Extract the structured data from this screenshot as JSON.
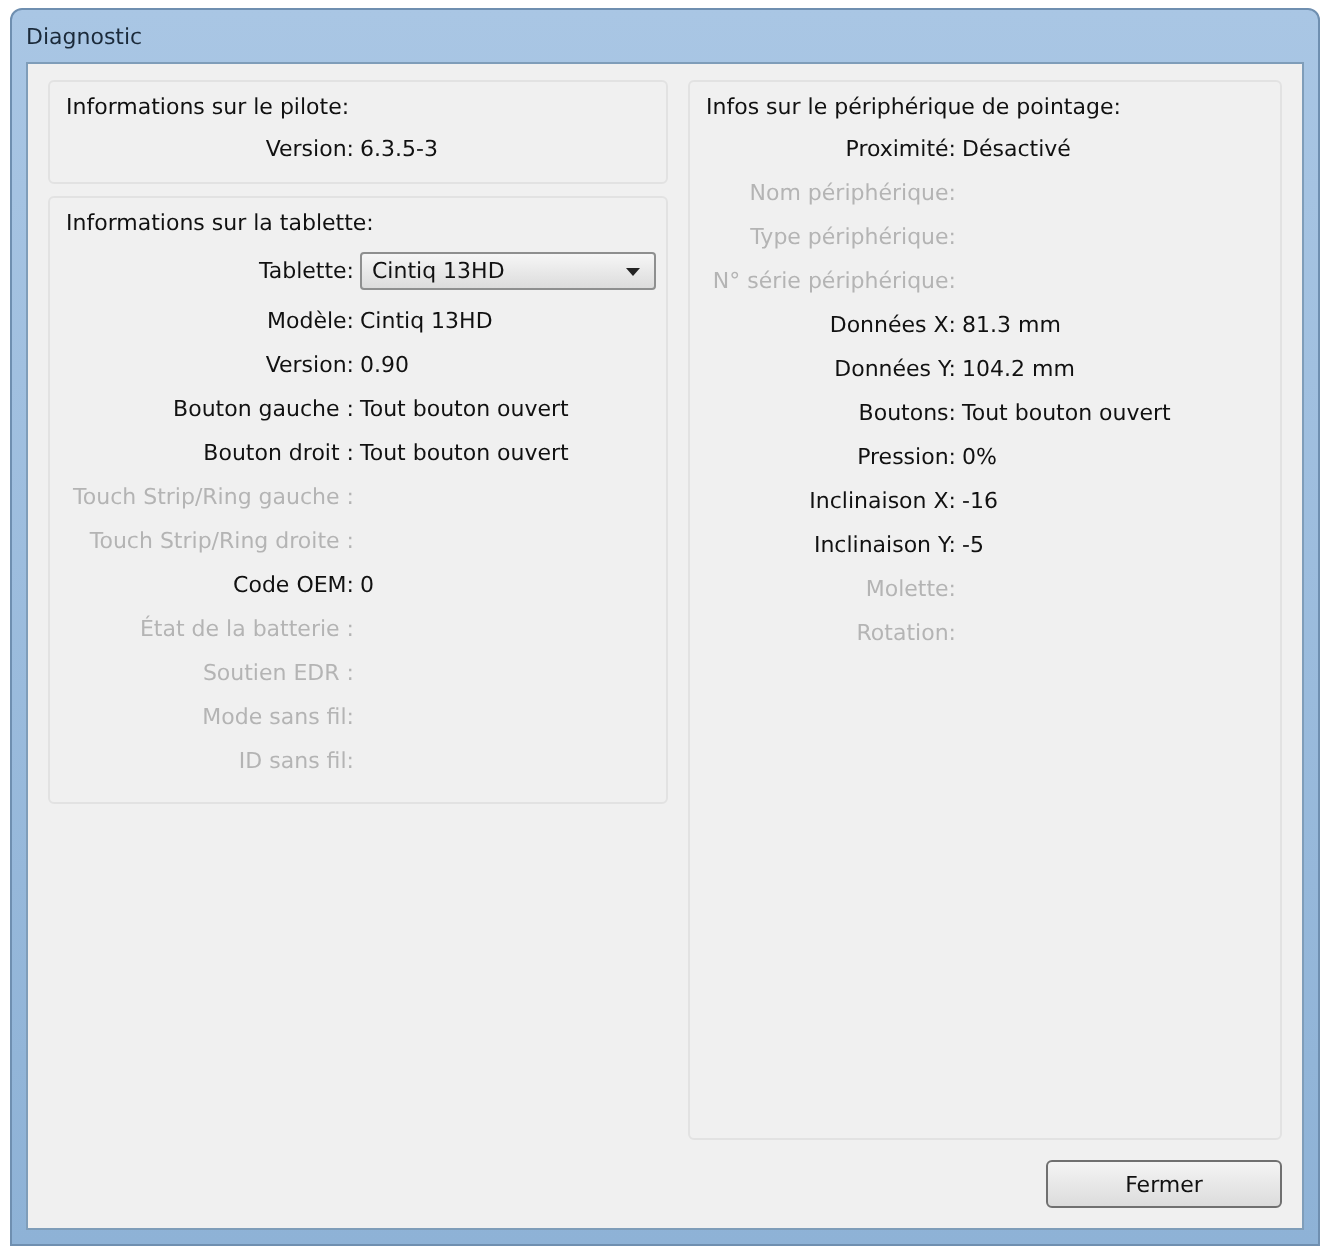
{
  "window": {
    "title": "Diagnostic"
  },
  "driver": {
    "title": "Informations sur le pilote:",
    "rows": [
      {
        "label": "Version:",
        "value": "6.3.5-3",
        "disabled": false
      }
    ]
  },
  "tablet": {
    "title": "Informations sur la tablette:",
    "rows": [
      {
        "kind": "dropdown",
        "label": "Tablette:",
        "value": "Cintiq 13HD",
        "disabled": false
      },
      {
        "kind": "text",
        "label": "Modèle:",
        "value": "Cintiq 13HD",
        "disabled": false
      },
      {
        "kind": "text",
        "label": "Version:",
        "value": "0.90",
        "disabled": false
      },
      {
        "kind": "text",
        "label": "Bouton gauche :",
        "value": "Tout bouton ouvert",
        "disabled": false
      },
      {
        "kind": "text",
        "label": "Bouton droit :",
        "value": "Tout bouton ouvert",
        "disabled": false
      },
      {
        "kind": "text",
        "label": "Touch Strip/Ring gauche :",
        "disabled": true
      },
      {
        "kind": "text",
        "label": "Touch Strip/Ring droite :",
        "disabled": true
      },
      {
        "kind": "text",
        "label": "Code OEM:",
        "value": "0",
        "disabled": false
      },
      {
        "kind": "text",
        "label": "État de la batterie :",
        "disabled": true
      },
      {
        "kind": "text",
        "label": "Soutien EDR :",
        "disabled": true
      },
      {
        "kind": "text",
        "label": "Mode sans fil:",
        "disabled": true
      },
      {
        "kind": "text",
        "label": "ID sans fil:",
        "disabled": true
      }
    ]
  },
  "pointer": {
    "title": "Infos sur le périphérique de pointage:",
    "rows": [
      {
        "label": "Proximité:",
        "value": "Désactivé",
        "disabled": false
      },
      {
        "label": "Nom périphérique:",
        "disabled": true
      },
      {
        "label": "Type périphérique:",
        "disabled": true
      },
      {
        "label": "N° série périphérique:",
        "disabled": true
      },
      {
        "label": "Données X:",
        "value": "81.3 mm",
        "disabled": false
      },
      {
        "label": "Données Y:",
        "value": "104.2 mm",
        "disabled": false
      },
      {
        "label": "Boutons:",
        "value": "Tout bouton ouvert",
        "disabled": false
      },
      {
        "label": "Pression:",
        "value": "0%",
        "disabled": false
      },
      {
        "label": "Inclinaison X:",
        "value": "-16",
        "disabled": false
      },
      {
        "label": "Inclinaison Y:",
        "value": "-5",
        "disabled": false
      },
      {
        "label": "Molette:",
        "disabled": true
      },
      {
        "label": "Rotation:",
        "disabled": true
      }
    ]
  },
  "buttons": [
    "Fermer"
  ]
}
